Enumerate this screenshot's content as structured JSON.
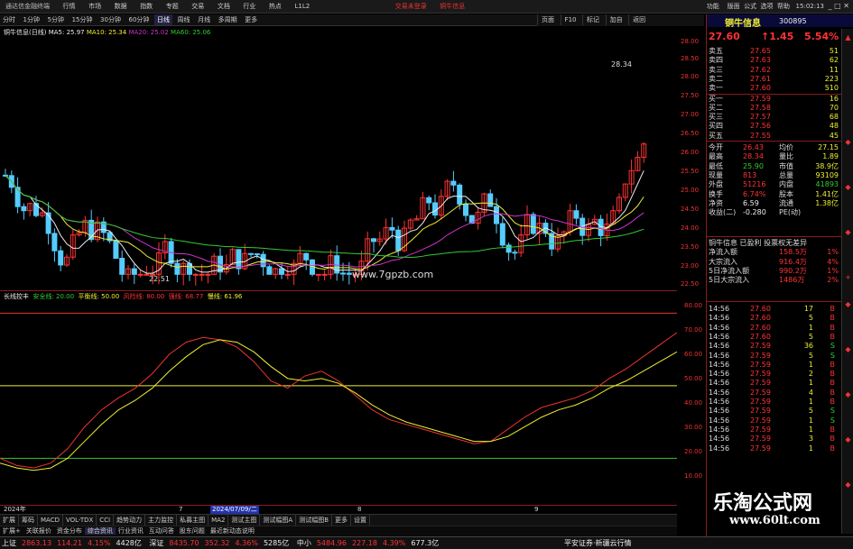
{
  "menubar": {
    "app_title": "通达信金融终端",
    "items": [
      "行情",
      "市场",
      "数据",
      "指数",
      "专题",
      "交易",
      "文档",
      "行业",
      "热点",
      "L1L2"
    ],
    "center_links": [
      "交易未登录",
      "铜牛信息"
    ],
    "right_items": [
      "功能",
      "版面",
      "公式",
      "选项",
      "帮助"
    ],
    "clock": "15:02:13"
  },
  "periodbar": {
    "items": [
      "分时",
      "1分钟",
      "5分钟",
      "15分钟",
      "30分钟",
      "60分钟",
      "日线",
      "周线",
      "月线",
      "多周期",
      "更多"
    ],
    "selected": "日线"
  },
  "right_toolbar": [
    "页面",
    "F10",
    "标记",
    "加自",
    "返回"
  ],
  "ma_legend": {
    "stock": "铜牛信息(日线)",
    "ma5": "MA5: 25.97",
    "ma10": "MA10: 25.34",
    "ma20": "MA20: 25.02",
    "ma60": "MA60: 25.06"
  },
  "price_axis": [
    "28.00",
    "28.50",
    "28.00",
    "27.50",
    "27.00",
    "26.50",
    "26.00",
    "25.50",
    "25.00",
    "24.50",
    "24.00",
    "23.50",
    "23.00",
    "22.50"
  ],
  "annotations": {
    "high": "28.34",
    "low": "22.51",
    "site": "www.7gpzb.com"
  },
  "indicator_legend": {
    "name": "长线控丰",
    "items": [
      {
        "label": "安全线: 20.00",
        "color": "#3c3"
      },
      {
        "label": "平衡线: 50.00",
        "color": "#ee3"
      },
      {
        "label": "风险线: 80.00",
        "color": "#e33"
      },
      {
        "label": "强线: 68.77",
        "color": "#e33"
      },
      {
        "label": "慢线: 61.96",
        "color": "#ee3"
      }
    ]
  },
  "indicator_axis": [
    "80.00",
    "70.00",
    "60.00",
    "50.00",
    "40.00",
    "30.00",
    "20.00",
    "10.00"
  ],
  "datebar": {
    "year": "2024年",
    "m1": "7",
    "selected_date": "2024/07/09/二",
    "m2": "8",
    "m3": "9"
  },
  "tabs": [
    "扩展",
    "筹码",
    "MACD",
    "VOL-TDX",
    "CCI",
    "趋势动力",
    "主力监控",
    "私募主图",
    "MA2",
    "测试主图",
    "测试幅图A",
    "测试幅图B",
    "更多",
    "设置"
  ],
  "tabs2": [
    "扩展+",
    "关联报价",
    "资金分布",
    "综合资讯",
    "行业资讯",
    "互动问答",
    "股东问题",
    "最近新动态说明"
  ],
  "quote": {
    "name": "铜牛信息",
    "code": "300895",
    "price": "27.60",
    "change": "↑1.45",
    "pct": "5.54%",
    "asks": [
      {
        "label": "卖五",
        "price": "27.65",
        "vol": "51"
      },
      {
        "label": "卖四",
        "price": "27.63",
        "vol": "62"
      },
      {
        "label": "卖三",
        "price": "27.62",
        "vol": "11"
      },
      {
        "label": "卖二",
        "price": "27.61",
        "vol": "223"
      },
      {
        "label": "卖一",
        "price": "27.60",
        "vol": "510"
      }
    ],
    "bids": [
      {
        "label": "买一",
        "price": "27.59",
        "vol": "16"
      },
      {
        "label": "买二",
        "price": "27.58",
        "vol": "70"
      },
      {
        "label": "买三",
        "price": "27.57",
        "vol": "68"
      },
      {
        "label": "买四",
        "price": "27.56",
        "vol": "48"
      },
      {
        "label": "买五",
        "price": "27.55",
        "vol": "45"
      }
    ],
    "stats": [
      {
        "a": "今开",
        "av": "26.43",
        "b": "均价",
        "bv": "27.15"
      },
      {
        "a": "最高",
        "av": "28.34",
        "b": "量比",
        "bv": "1.89"
      },
      {
        "a": "最低",
        "av": "25.90",
        "b": "市值",
        "bv": "38.9亿"
      },
      {
        "a": "现量",
        "av": "813",
        "b": "总量",
        "bv": "93109"
      },
      {
        "a": "外盘",
        "av": "51216",
        "b": "内盘",
        "bv": "41893"
      },
      {
        "a": "换手",
        "av": "6.74%",
        "b": "股本",
        "bv": "1.41亿"
      },
      {
        "a": "净资",
        "av": "6.59",
        "b": "流通",
        "bv": "1.38亿"
      },
      {
        "a": "收益(二)",
        "av": "-0.280",
        "b": "PE(动)",
        "bv": ""
      }
    ],
    "tags": "铜牛信息 已盈利 投票权无差异",
    "flows": [
      {
        "label": "净流入额",
        "val": "158.5万",
        "pct": "1%"
      },
      {
        "label": "大宗流入",
        "val": "916.4万",
        "pct": "4%"
      },
      {
        "label": "5日净流入额",
        "val": "990.2万",
        "pct": "1%"
      },
      {
        "label": "5日大宗流入",
        "val": "1486万",
        "pct": "2%"
      }
    ],
    "ticks": [
      {
        "t": "14:56",
        "p": "27.60",
        "v": "17",
        "s": "B"
      },
      {
        "t": "14:56",
        "p": "27.60",
        "v": "5",
        "s": "B"
      },
      {
        "t": "14:56",
        "p": "27.60",
        "v": "1",
        "s": "B"
      },
      {
        "t": "14:56",
        "p": "27.60",
        "v": "5",
        "s": "B"
      },
      {
        "t": "14:56",
        "p": "27.59",
        "v": "36",
        "s": "S"
      },
      {
        "t": "14:56",
        "p": "27.59",
        "v": "5",
        "s": "S"
      },
      {
        "t": "14:56",
        "p": "27.59",
        "v": "1",
        "s": "B"
      },
      {
        "t": "14:56",
        "p": "27.59",
        "v": "2",
        "s": "B"
      },
      {
        "t": "14:56",
        "p": "27.59",
        "v": "1",
        "s": "B"
      },
      {
        "t": "14:56",
        "p": "27.59",
        "v": "4",
        "s": "B"
      },
      {
        "t": "14:56",
        "p": "27.59",
        "v": "1",
        "s": "B"
      },
      {
        "t": "14:56",
        "p": "27.59",
        "v": "5",
        "s": "S"
      },
      {
        "t": "14:56",
        "p": "27.59",
        "v": "1",
        "s": "S"
      },
      {
        "t": "14:56",
        "p": "27.59",
        "v": "1",
        "s": "B"
      },
      {
        "t": "14:56",
        "p": "27.59",
        "v": "3",
        "s": "B"
      },
      {
        "t": "14:56",
        "p": "27.59",
        "v": "1",
        "s": "B"
      }
    ]
  },
  "watermark": {
    "cn": "乐淘公式网",
    "url": "www.60lt.com"
  },
  "status": {
    "items": [
      {
        "label": "上证",
        "val": "2863.13",
        "chg": "114.21",
        "pct": "4.15%",
        "amt": "4428亿"
      },
      {
        "label": "深证",
        "val": "8435.70",
        "chg": "352.32",
        "pct": "4.36%",
        "amt": "5285亿"
      },
      {
        "label": "中小",
        "val": "5484.96",
        "chg": "227.18",
        "pct": "4.39%",
        "amt": "677.3亿"
      }
    ],
    "broker": "平安证券·新疆云行情"
  }
}
